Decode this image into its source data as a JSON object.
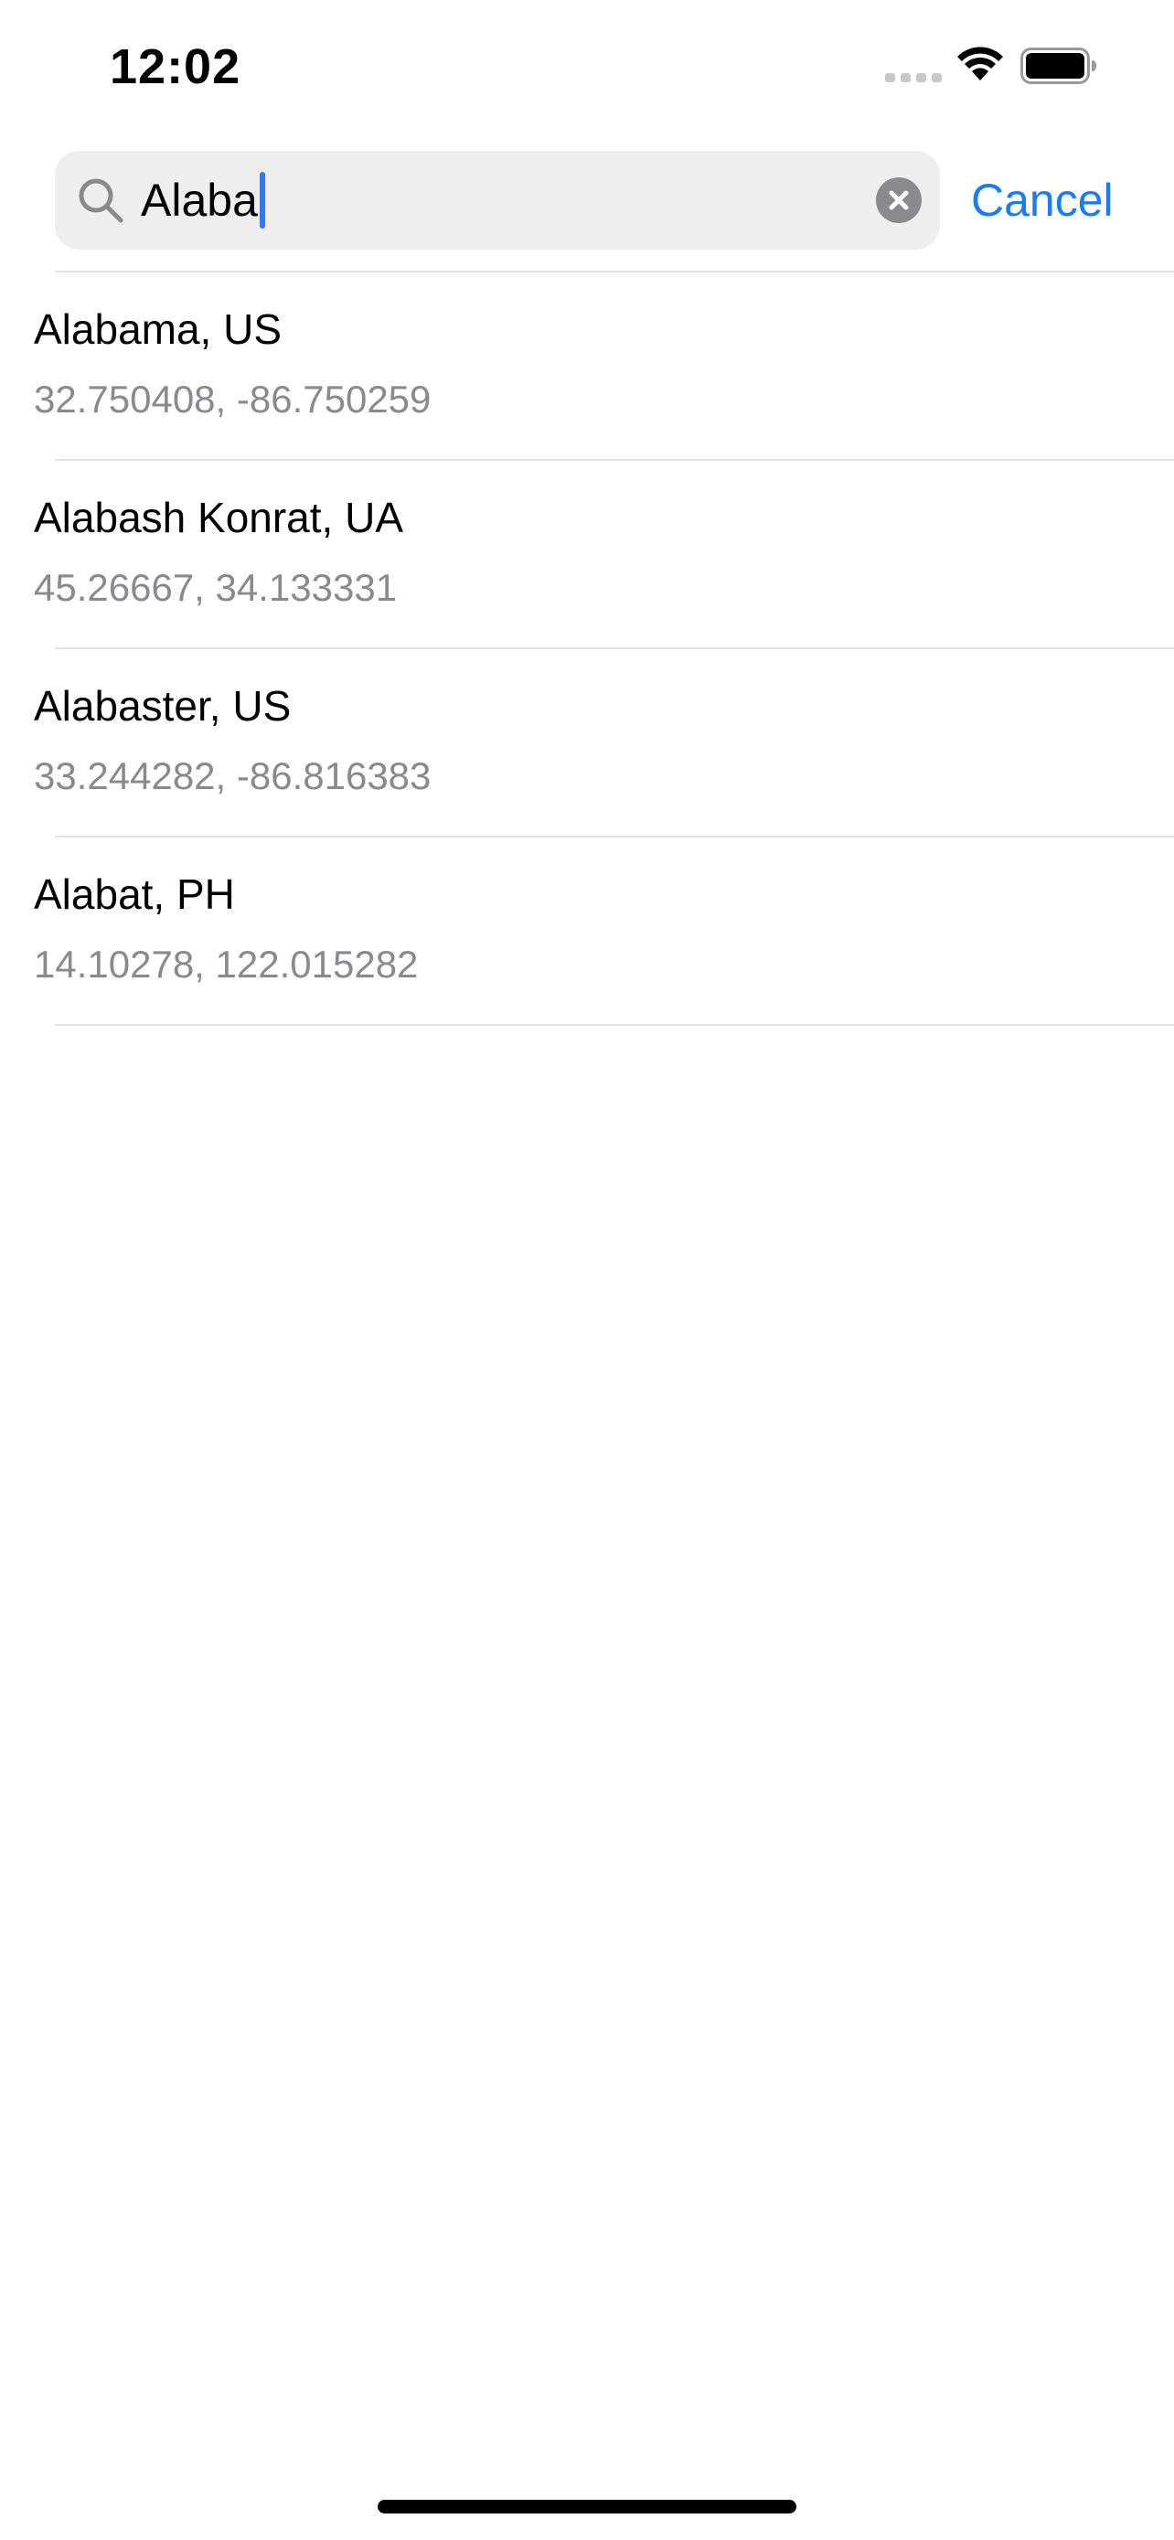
{
  "status_bar": {
    "time": "12:02"
  },
  "search": {
    "query": "Alaba",
    "cancel_label": "Cancel"
  },
  "results": [
    {
      "title": "Alabama, US",
      "coords": "32.750408, -86.750259"
    },
    {
      "title": "Alabash Konrat, UA",
      "coords": "45.26667, 34.133331"
    },
    {
      "title": "Alabaster, US",
      "coords": "33.244282, -86.816383"
    },
    {
      "title": "Alabat, PH",
      "coords": "14.10278, 122.015282"
    }
  ],
  "colors": {
    "accent": "#1a7cf5",
    "secondary_text": "#8a8a8e",
    "search_background": "#eeeeef",
    "cursor": "#3478f6"
  },
  "icons": {
    "signal": "cellular-signal-icon",
    "wifi": "wifi-icon",
    "battery": "battery-icon",
    "search": "magnifying-glass-icon",
    "clear": "clear-circle-x-icon"
  }
}
